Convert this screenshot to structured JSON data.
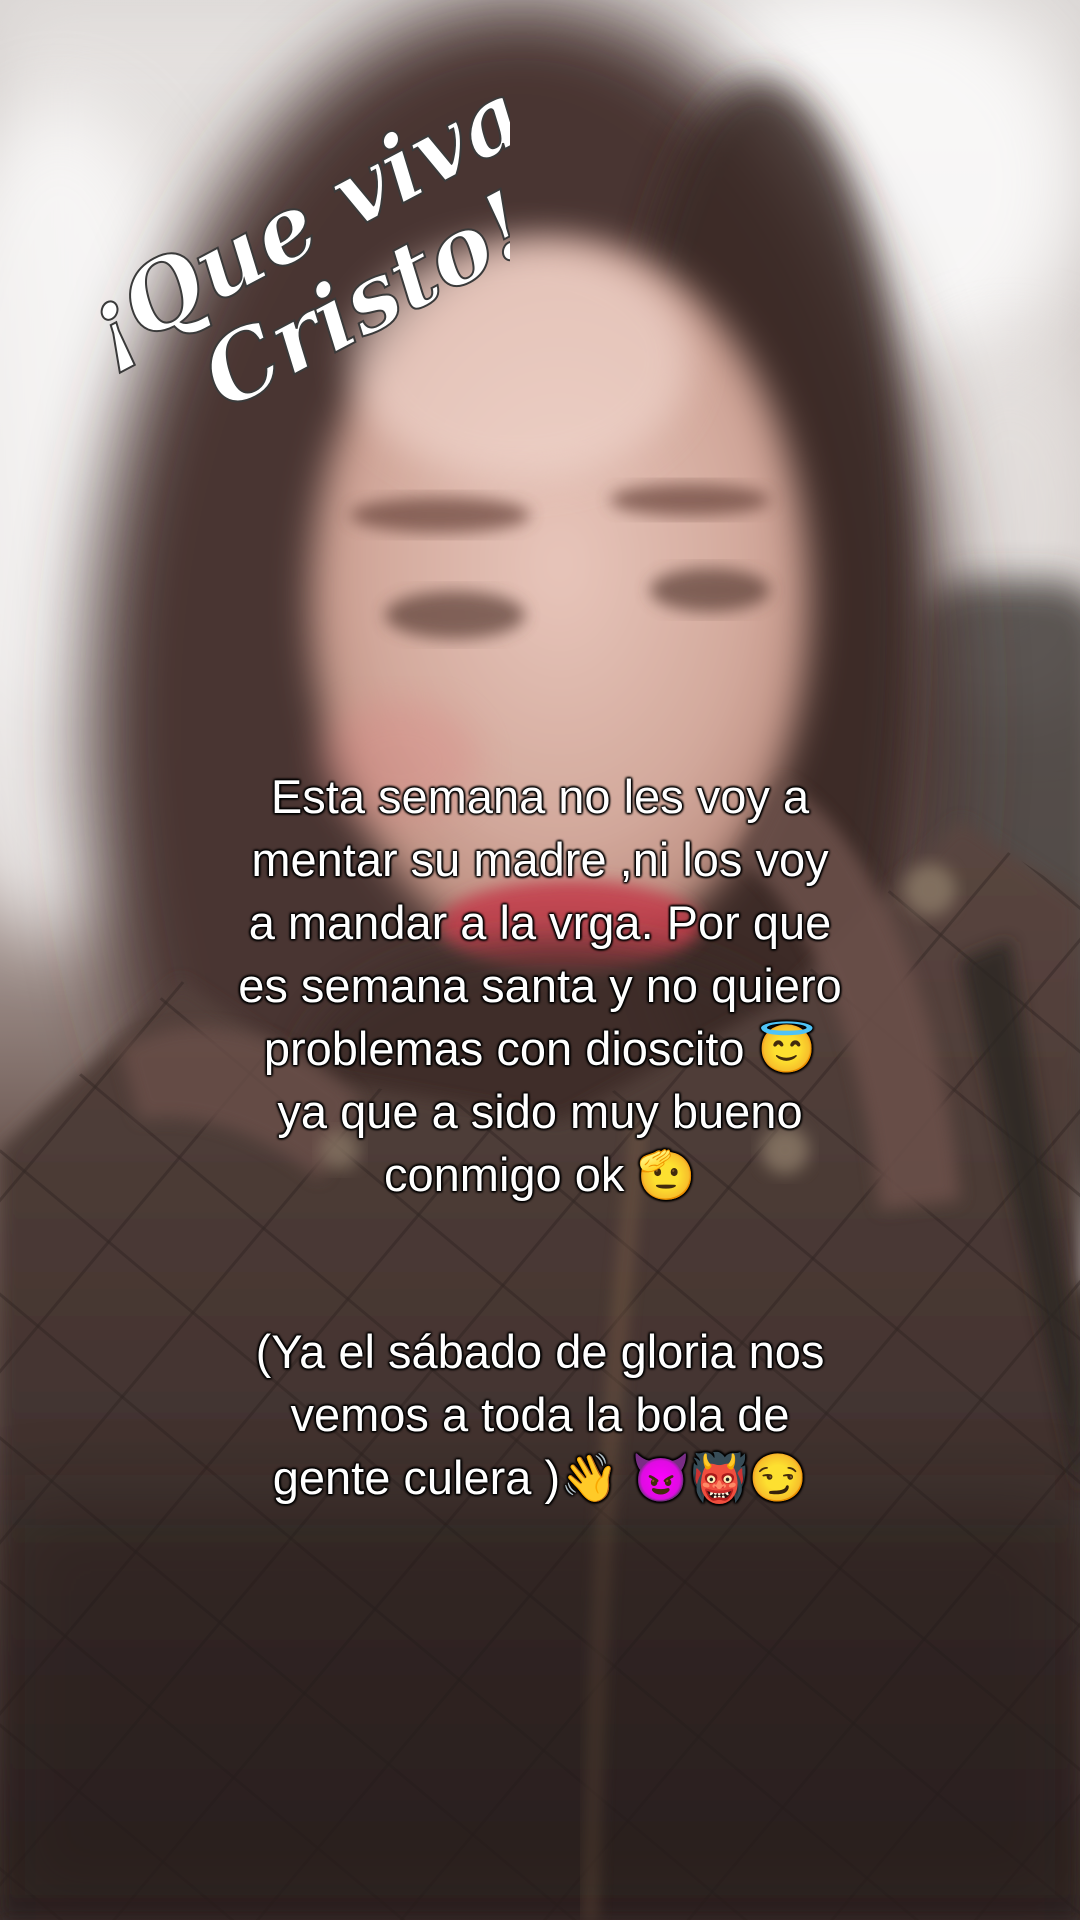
{
  "sticker": {
    "text_line1": "¡Que viva",
    "text_line2": "Cristo!"
  },
  "caption_main": {
    "lines": [
      "Esta semana no les voy a",
      "mentar su madre ,ni los voy",
      "a mandar a la vrga. Por que",
      "es semana santa y no quiero",
      "problemas con dioscito 😇",
      "ya que a sido muy bueno",
      "conmigo ok 🫡"
    ]
  },
  "caption_secondary": {
    "lines": [
      "(Ya el sábado de gloria nos",
      "vemos a toda la bola de",
      "gente culera )👋 😈👹😏"
    ]
  },
  "colors": {
    "caption_text": "#ffffff",
    "caption_outline": "#000000",
    "sticker_fill": "#ffffff"
  }
}
